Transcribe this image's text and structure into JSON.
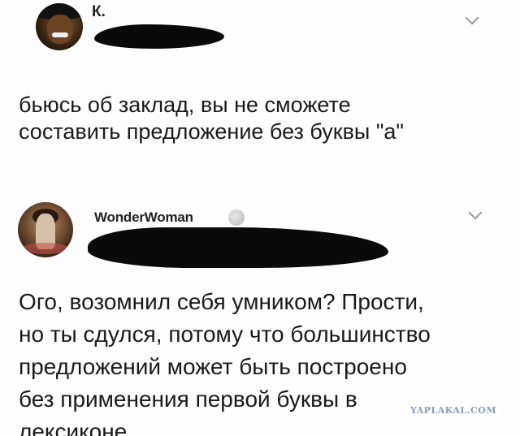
{
  "posts": [
    {
      "username": "К.",
      "text": "бьюсь об заклад, вы не сможете\nсоставить предложение без буквы \"а\"",
      "avatar_icon": "avatar-man-hat-icon",
      "menu_icon": "chevron-down-icon"
    },
    {
      "username": "WonderWoman",
      "badge_icon": "verified-badge-icon",
      "text": "Ого, возомнил себя умником? Прости,\nно ты сдулся, потому что большинство\nпредложений может быть построено\nбез применения первой буквы в\nлексиконе",
      "avatar_icon": "avatar-woman-icon",
      "menu_icon": "chevron-down-icon"
    }
  ],
  "watermark": "YAPLAKAL.COM",
  "colors": {
    "background": "#fdfdfd",
    "text": "#1a1a1a",
    "chevron": "#9a9a9a",
    "redaction": "#0a0a0a",
    "watermark": "#8a9ab8"
  }
}
